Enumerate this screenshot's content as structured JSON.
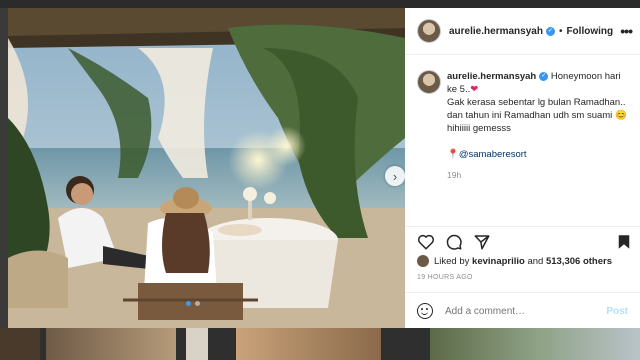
{
  "post": {
    "username": "aurelie.hermansyah",
    "follow_status": "Following",
    "bullet": "•",
    "more": "•••",
    "caption": {
      "username": "aurelie.hermansyah",
      "line1": "Honeymoon hari ke 5..",
      "heart": "❤",
      "line2": "Gak kerasa sebentar lg bulan Ramadhan.. dan tahun ini Ramadhan udh sm suami",
      "emoji": "😊",
      "line3": "hihiiiii gemesss",
      "pin": "📍",
      "mention": "@samaberesort",
      "time": "19h"
    },
    "likes": {
      "prefix": "Liked by",
      "user": "kevinaprilio",
      "and": "and",
      "count": "513,306 others"
    },
    "time_ago": "19 HOURS AGO",
    "comment_placeholder": "Add a comment…",
    "post_label": "Post",
    "next_arrow": "›"
  }
}
